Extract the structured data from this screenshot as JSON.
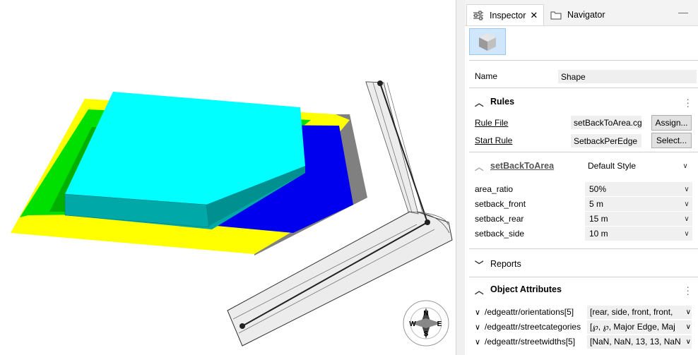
{
  "inspector": {
    "tabs": [
      {
        "label": "Inspector",
        "icon": "sliders-icon"
      },
      {
        "label": "Navigator",
        "icon": "folder-icon"
      }
    ],
    "name_label": "Name",
    "name_value": "Shape",
    "rules": {
      "title": "Rules",
      "rule_file_label": "Rule File",
      "rule_file_value": "setBackToArea.cga",
      "assign_button": "Assign...",
      "start_rule_label": "Start Rule",
      "start_rule_value": "SetbackPerEdge",
      "select_button": "Select..."
    },
    "style": {
      "rule_name": "setBackToArea",
      "style_value": "Default Style"
    },
    "attributes": [
      {
        "name": "area_ratio",
        "value": "50%"
      },
      {
        "name": "setback_front",
        "value": "5 m"
      },
      {
        "name": "setback_rear",
        "value": "15 m"
      },
      {
        "name": "setback_side",
        "value": "10 m"
      }
    ],
    "reports_title": "Reports",
    "object_attributes": {
      "title": "Object Attributes",
      "rows": [
        {
          "name": "/edgeattr/orientations[5]",
          "value": "[rear, side, front, front,"
        },
        {
          "name": "/edgeattr/streetcategories",
          "value": "[℘, ℘, Major Edge, Maj"
        },
        {
          "name": "/edgeattr/streetwidths[5]",
          "value": "[NaN, NaN, 13, 13, NaN"
        }
      ]
    }
  },
  "compass": {
    "north": "N",
    "east": "E",
    "south": "S",
    "west": "W"
  },
  "colors": {
    "building_top": "#00ffff",
    "building_side": "#00a8a8",
    "lot_yellow": "#ffff00",
    "lot_green": "#00e000",
    "lot_blue": "#0000ee",
    "lot_gray": "#808080",
    "street": "#ececec"
  }
}
